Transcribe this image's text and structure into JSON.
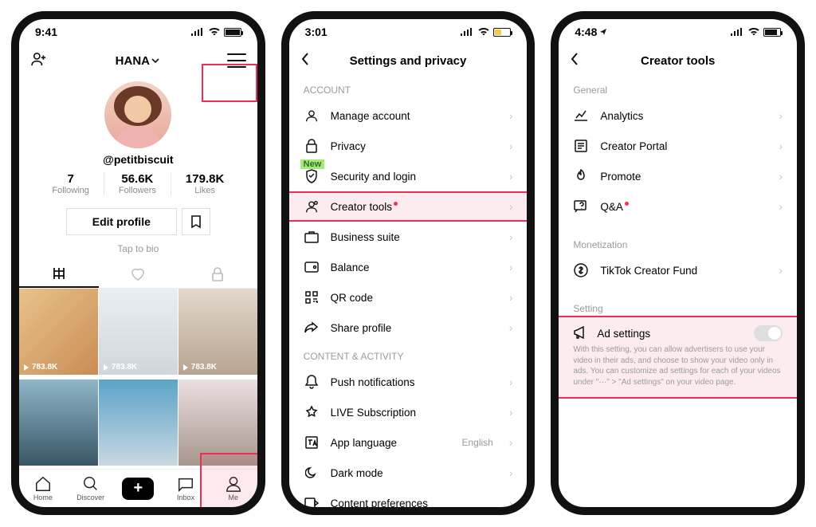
{
  "phone1": {
    "time": "9:41",
    "header": {
      "add_person": "add-person",
      "name": "HANA",
      "hamburger": "menu"
    },
    "handle": "@petitbiscuit",
    "stats": [
      {
        "n": "7",
        "l": "Following"
      },
      {
        "n": "56.6K",
        "l": "Followers"
      },
      {
        "n": "179.8K",
        "l": "Likes"
      }
    ],
    "edit": "Edit profile",
    "bio": "Tap to bio",
    "views": "783.8K",
    "tabbar": [
      "Home",
      "Discover",
      "",
      "Inbox",
      "Me"
    ]
  },
  "phone2": {
    "time": "3:01",
    "title": "Settings and privacy",
    "new": "New",
    "sect1": "ACCOUNT",
    "items1": [
      "Manage account",
      "Privacy",
      "Security and login",
      "Creator tools",
      "Business suite",
      "Balance",
      "QR code",
      "Share profile"
    ],
    "sect2": "CONTENT & ACTIVITY",
    "items2": [
      "Push notifications",
      "LIVE Subscription",
      "App language",
      "Dark mode",
      "Content preferences"
    ],
    "lang": "English"
  },
  "phone3": {
    "time": "4:48",
    "title": "Creator tools",
    "sect1": "General",
    "items1": [
      "Analytics",
      "Creator Portal",
      "Promote",
      "Q&A"
    ],
    "sect2": "Monetization",
    "items2": [
      "TikTok Creator Fund"
    ],
    "sect3": "Setting",
    "ad_title": "Ad settings",
    "ad_desc": "With this setting, you can allow advertisers to use your video in their ads, and choose to show your video only in ads. You can customize ad settings for each of your videos under \"···\" > \"Ad settings\" on your video page."
  }
}
